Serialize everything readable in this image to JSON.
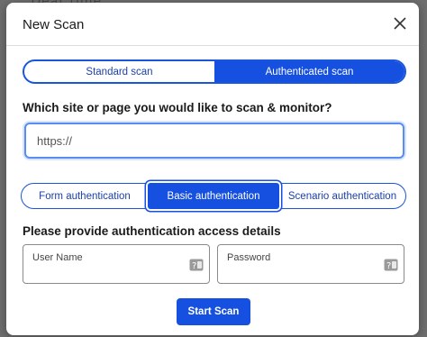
{
  "backdrop": {
    "text": "...Dear time..."
  },
  "modal": {
    "title": "New Scan",
    "scan_type_tabs": [
      {
        "label": "Standard scan",
        "active": false
      },
      {
        "label": "Authenticated scan",
        "active": true
      }
    ],
    "question": "Which site or page you would like to scan & monitor?",
    "url_field": {
      "value": "",
      "placeholder": "https://"
    },
    "auth_tabs": [
      {
        "label": "Form authentication",
        "active": false
      },
      {
        "label": "Basic authentication",
        "active": true
      },
      {
        "label": "Scenario authentication",
        "active": false
      }
    ],
    "details_label": "Please provide authentication access details",
    "username": {
      "label": "User Name",
      "value": ""
    },
    "password": {
      "label": "Password",
      "value": ""
    },
    "start_button": "Start Scan"
  },
  "colors": {
    "accent": "#1650e0",
    "accent_text": "#1a3fa8",
    "focus_border": "#5b8cf0"
  },
  "icons": {
    "close": "close-icon",
    "credential_helper": "password-key-icon"
  }
}
